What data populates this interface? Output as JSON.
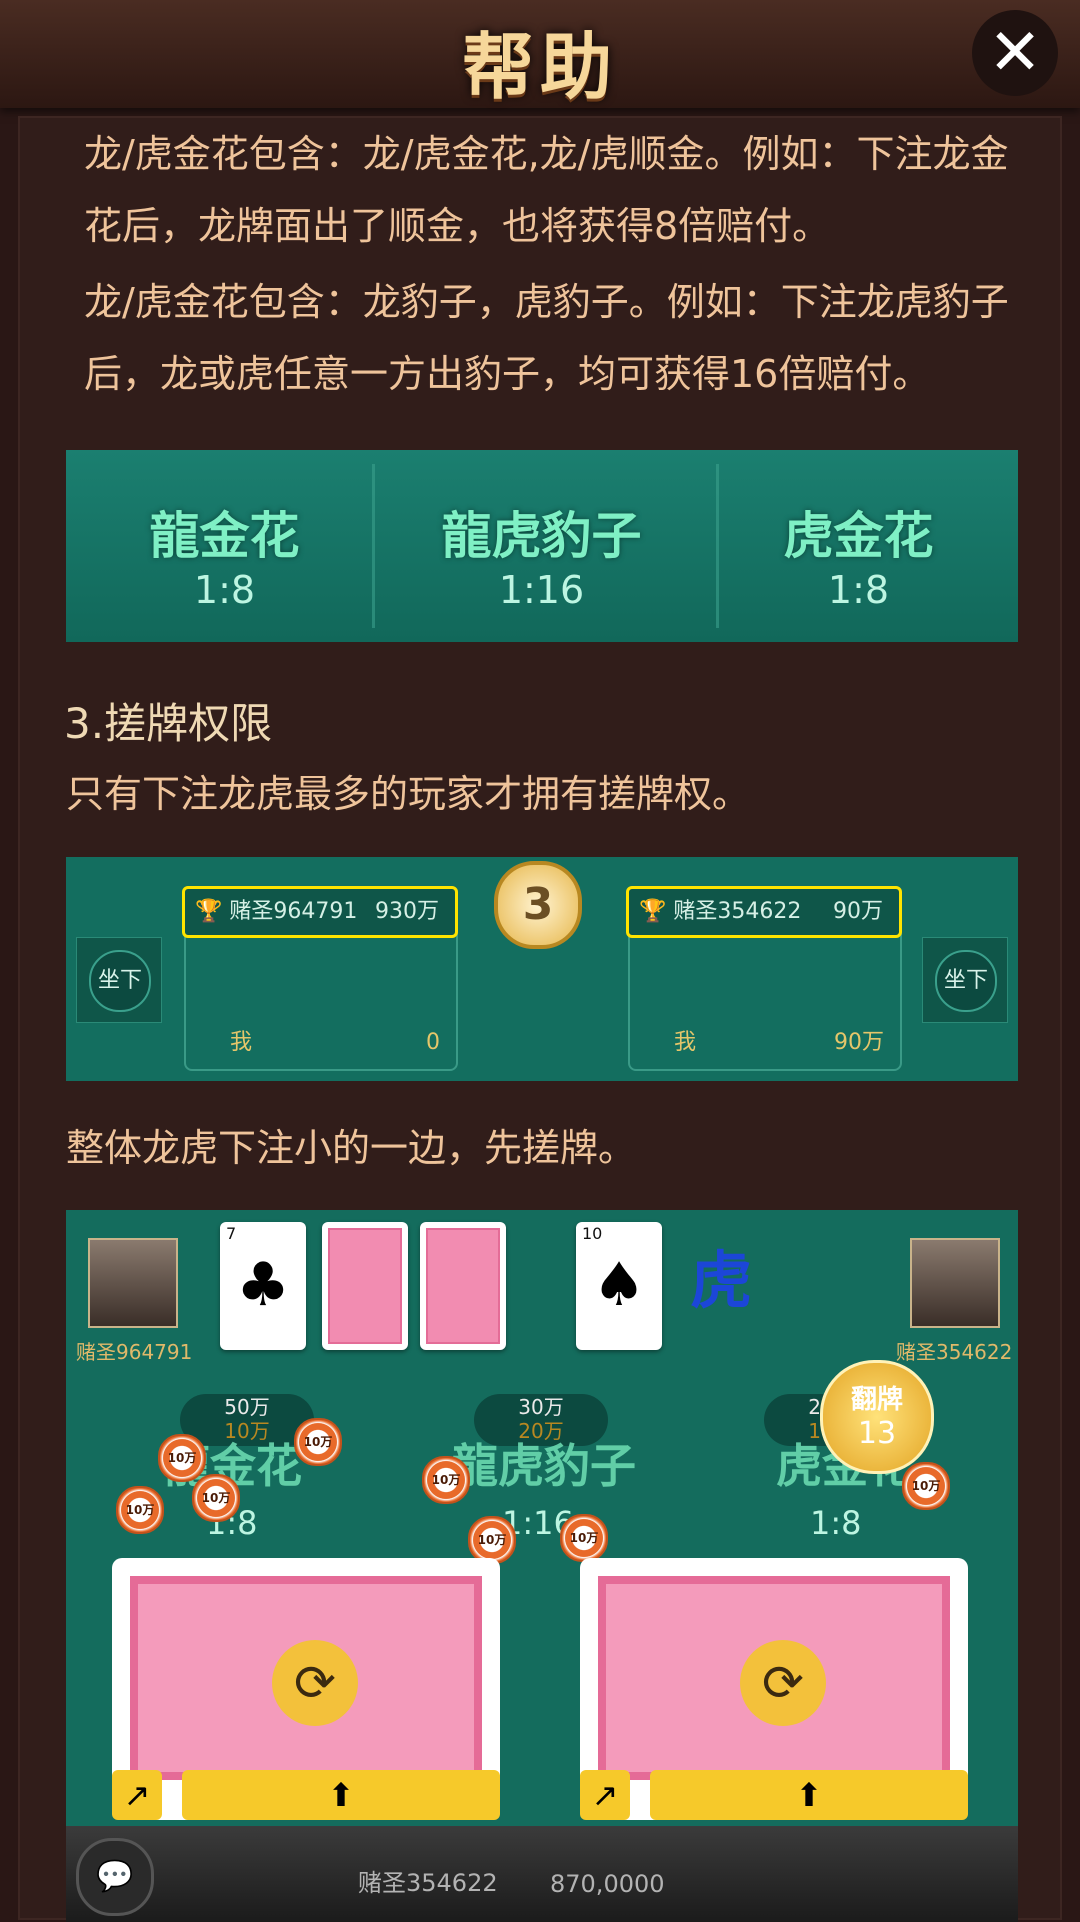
{
  "header": {
    "title": "帮助",
    "close_icon": "close-icon"
  },
  "paragraphs": {
    "p1": "龙/虎金花包含：龙/虎金花,龙/虎顺金。例如：下注龙金花后，龙牌面出了顺金，也将获得8倍赔付。",
    "p2": "龙/虎金花包含：龙豹子，虎豹子。例如：下注龙虎豹子后，龙或虎任意一方出豹子，均可获得16倍赔付。",
    "section3": "3.搓牌权限",
    "p3": "只有下注龙虎最多的玩家才拥有搓牌权。",
    "p4": "整体龙虎下注小的一边，先搓牌。"
  },
  "odds": [
    {
      "name": "龍金花",
      "ratio": "1:8"
    },
    {
      "name": "龍虎豹子",
      "ratio": "1:16"
    },
    {
      "name": "虎金花",
      "ratio": "1:8"
    }
  ],
  "panel2": {
    "sit_label": "坐下",
    "timer": "3",
    "left": {
      "player": "赌圣964791",
      "amount": "930万",
      "me_label": "我",
      "me_amount": "0"
    },
    "right": {
      "player": "赌圣354622",
      "amount": "90万",
      "me_label": "我",
      "me_amount": "90万"
    }
  },
  "panel3": {
    "left_player": "赌圣964791",
    "right_player": "赌圣354622",
    "tiger_label": "虎",
    "pills": [
      {
        "total": "50万",
        "mine": "10万"
      },
      {
        "total": "30万",
        "mine": "20万"
      },
      {
        "total": "20万",
        "mine": "10万"
      }
    ],
    "areas": [
      {
        "name": "龍金花",
        "ratio": "1:8"
      },
      {
        "name": "龍虎豹子",
        "ratio": "1:16"
      },
      {
        "name": "虎金花",
        "ratio": "1:8"
      }
    ],
    "chip_label": "10万",
    "flip": {
      "label": "翻牌",
      "count": "13"
    },
    "bottom_player": "赌圣354622",
    "bottom_amount": "870,0000",
    "cards": {
      "c1_rank": "7",
      "c1_suit": "♣",
      "c4_rank": "10",
      "c4_suit": "♠"
    }
  }
}
